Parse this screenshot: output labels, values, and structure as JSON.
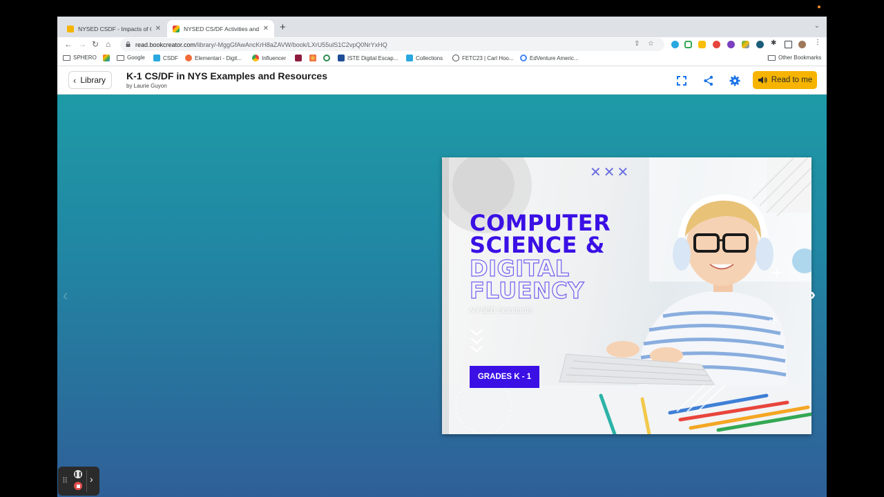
{
  "tabs": [
    {
      "title": "NYSED CSDF - Impacts of Com",
      "active": false,
      "favicon_color": "#f4b400"
    },
    {
      "title": "NYSED CS/DF Activities and Ex",
      "active": true,
      "favicon_color": "#e8453c"
    }
  ],
  "address_bar": {
    "host": "read.bookcreator.com",
    "path": "/library/-MggGfAwAncKrH8aZAVW/book/LXrU55ulS1C2vpQ0NrYxHQ"
  },
  "bookmarks": [
    {
      "label": "SPHERO",
      "icon": "folder-icon"
    },
    {
      "label": "",
      "icon": "colorful-app-icon"
    },
    {
      "label": "Google",
      "icon": "folder-icon"
    },
    {
      "label": "CSDF",
      "icon": "w-icon"
    },
    {
      "label": "Elementari - Digit...",
      "icon": "elementari-icon"
    },
    {
      "label": "Influencer",
      "icon": "chrome-icon"
    },
    {
      "label": "",
      "icon": "mw-icon"
    },
    {
      "label": "",
      "icon": "star-icon"
    },
    {
      "label": "",
      "icon": "swirl-icon"
    },
    {
      "label": "ISTE Digital Escap...",
      "icon": "calendar-icon"
    },
    {
      "label": "Collections",
      "icon": "w-icon"
    },
    {
      "label": "FETC23 | Carl Hoo...",
      "icon": "wordpress-icon"
    },
    {
      "label": "EdVenture Americ...",
      "icon": "chrome-icon"
    }
  ],
  "other_bookmarks": "Other Bookmarks",
  "header": {
    "library_label": "Library",
    "book_title": "K-1 CS/DF in NYS Examples and Resources",
    "author": "by Laurie Guyon",
    "read_to_me_label": "Read to me"
  },
  "cover": {
    "line1": "COMPUTER",
    "line2": "SCIENCE &",
    "line3": "DIGITAL",
    "line4": "FLUENCY",
    "subtitle": "NYSED Standards",
    "grades_button": "GRADES K - 1",
    "decoration": "✕✕✕"
  },
  "colors": {
    "accent_yellow": "#f6b400",
    "cover_purple": "#3a10e5",
    "reader_teal": "#1e9aa6",
    "reader_blue": "#2f5f98",
    "icon_blue": "#1a73e8"
  }
}
